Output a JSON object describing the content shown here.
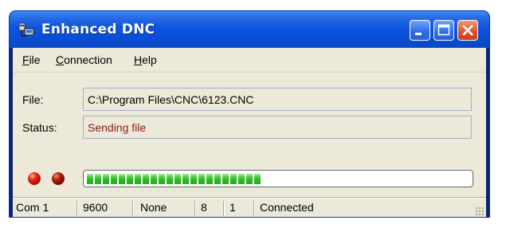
{
  "window": {
    "title": "Enhanced DNC",
    "icons": {
      "app": "dnc-app-icon",
      "minimize": "minimize-icon",
      "maximize": "maximize-icon",
      "close": "close-icon"
    }
  },
  "menu": {
    "file": {
      "first": "F",
      "rest": "ile"
    },
    "connection": {
      "first": "C",
      "rest": "onnection"
    },
    "help": {
      "first": "H",
      "rest": "elp"
    }
  },
  "form": {
    "file_label": "File:",
    "file_value": "C:\\Program Files\\CNC\\6123.CNC",
    "status_label": "Status:",
    "status_value": "Sending file"
  },
  "indicators": {
    "led1": "red",
    "led2": "dark-red"
  },
  "progress": {
    "fraction": 0.5,
    "segments_filled": 22
  },
  "statusbar": {
    "port": "Com 1",
    "baud": "9600",
    "parity": "None",
    "databits": "8",
    "stopbits": "1",
    "state": "Connected"
  },
  "colors": {
    "status_text": "#8b1a1a",
    "title_bar": "#0a4fd6",
    "progress": "#2fc02a"
  }
}
